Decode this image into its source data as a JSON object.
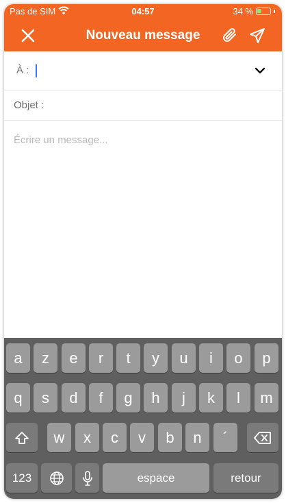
{
  "status_bar": {
    "carrier": "Pas de SIM",
    "time": "04:57",
    "battery": "34 %",
    "battery_level": 0.34
  },
  "header": {
    "title": "Nouveau message",
    "close_icon": "close-icon",
    "attach_icon": "paperclip-icon",
    "send_icon": "send-icon"
  },
  "compose": {
    "to_label": "À :",
    "subject_label": "Objet :",
    "body_placeholder": "Écrire un message..."
  },
  "keyboard": {
    "row1": [
      "a",
      "z",
      "e",
      "r",
      "t",
      "y",
      "u",
      "i",
      "o",
      "p"
    ],
    "row2": [
      "q",
      "s",
      "d",
      "f",
      "g",
      "h",
      "j",
      "k",
      "l",
      "m"
    ],
    "row3": [
      "w",
      "x",
      "c",
      "v",
      "b",
      "n",
      "´"
    ],
    "numbers_key": "123",
    "space_key": "espace",
    "return_key": "retour"
  },
  "colors": {
    "accent": "#f26522",
    "keyboard_bg": "#5f5f5f",
    "key_bg": "#9b9b9b"
  }
}
